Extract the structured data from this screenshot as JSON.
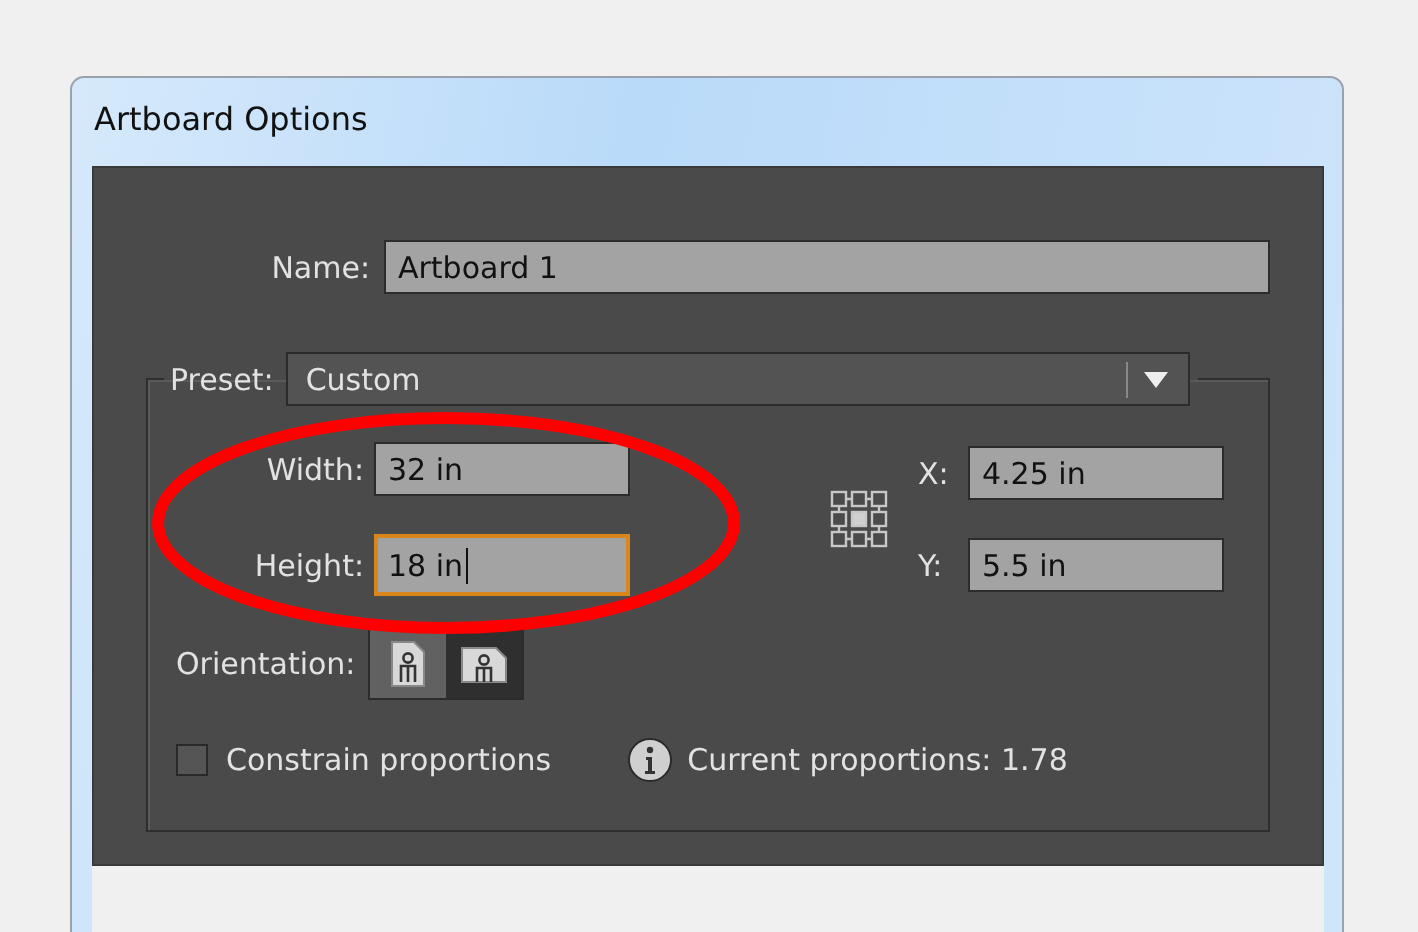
{
  "window": {
    "title": "Artboard Options"
  },
  "name": {
    "label": "Name:",
    "value": "Artboard 1"
  },
  "preset": {
    "label": "Preset:",
    "value": "Custom"
  },
  "size_fields": [
    {
      "label": "Width:",
      "value": "32 in",
      "focused": false
    },
    {
      "label": "Height:",
      "value": "18 in",
      "focused": true
    }
  ],
  "position_fields": [
    {
      "label": "X:",
      "value": "4.25 in"
    },
    {
      "label": "Y:",
      "value": "5.5 in"
    }
  ],
  "orientation": {
    "label": "Orientation:",
    "options": [
      {
        "kind": "portrait",
        "selected": true
      },
      {
        "kind": "landscape",
        "selected": false
      }
    ]
  },
  "constrain_proportions": {
    "label": "Constrain proportions",
    "checked": false
  },
  "current_proportions": "Current proportions: 1.78",
  "annotations": [
    {
      "kind": "ellipse",
      "color": "#ff0000"
    }
  ]
}
